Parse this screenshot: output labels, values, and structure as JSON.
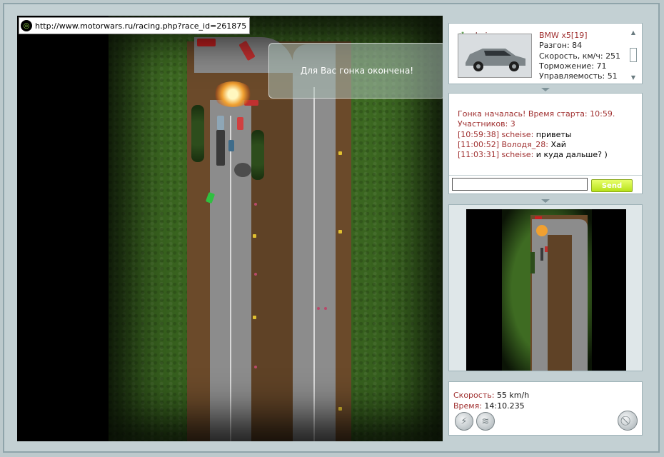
{
  "browser": {
    "url": "http://www.motorwars.ru/racing.php?race_id=261875"
  },
  "game": {
    "message": "Для Вас гонка окончена!"
  },
  "player": {
    "name": "scheise",
    "car_model": "BMW x5[19]",
    "stats": [
      {
        "label": "Разгон",
        "value": "84"
      },
      {
        "label": "Скорость, км/ч",
        "value": "251"
      },
      {
        "label": "Торможение",
        "value": "71"
      },
      {
        "label": "Управляемость",
        "value": "51"
      }
    ]
  },
  "chat": {
    "system": [
      "Гонка началась! Время старта: 10:59.",
      "Участников: 3"
    ],
    "messages": [
      {
        "time": "[10:59:38]",
        "nick": "scheise",
        "text": "приветы"
      },
      {
        "time": "[11:00:52]",
        "nick": "Володя_28",
        "text": "Хай"
      },
      {
        "time": "[11:03:31]",
        "nick": "scheise",
        "text": "и куда дальше? )"
      }
    ],
    "input_value": "",
    "send_label": "Send"
  },
  "status": {
    "speed_label": "Скорость:",
    "speed_value": "55 km/h",
    "time_label": "Время:",
    "time_value": "14:10.235"
  },
  "icons": {
    "boost": "lightning-icon",
    "signal": "wifi-icon",
    "quit": "no-entry-icon"
  },
  "colors": {
    "accent_red": "#a03030",
    "send_button": "#b7e21a",
    "grass": "#3e6b22",
    "road": "#8c8c8c"
  }
}
